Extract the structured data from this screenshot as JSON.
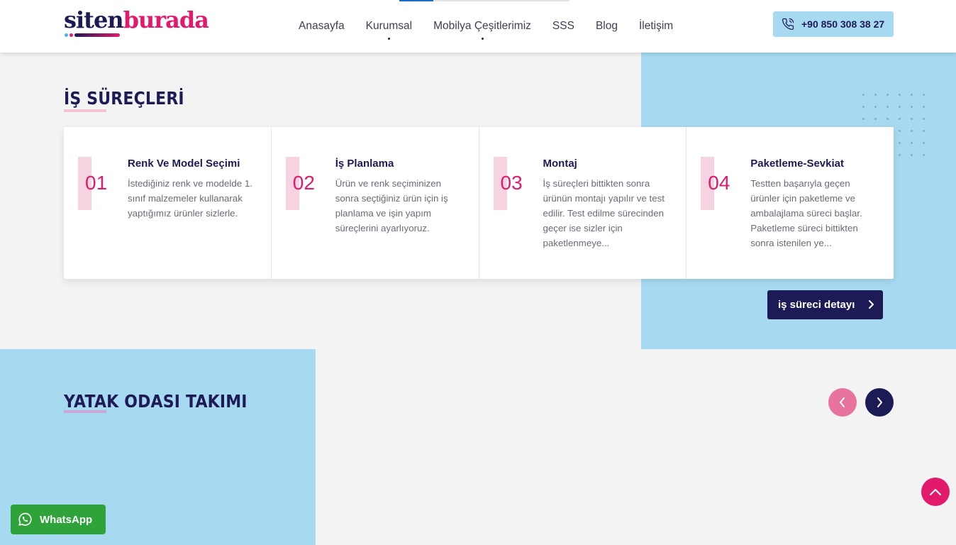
{
  "header": {
    "logo_part1": "siten",
    "logo_part2": "burada",
    "nav": [
      {
        "label": "Anasayfa"
      },
      {
        "label": "Kurumsal"
      },
      {
        "label": "Mobilya Çeşitlerimiz"
      },
      {
        "label": "SSS"
      },
      {
        "label": "Blog"
      },
      {
        "label": "İletişim"
      }
    ],
    "phone": "+90 850 308 38 27"
  },
  "process": {
    "title": "İŞ SÜREÇLERİ",
    "steps": [
      {
        "num": "01",
        "title": "Renk Ve Model Seçimi",
        "desc": "İstediğiniz renk ve modelde 1. sınıf malzemeler kullanarak yaptığımız ürünler sizlerle."
      },
      {
        "num": "02",
        "title": "İş Planlama",
        "desc": "Ürün ve renk seçiminizen sonra seçtiğiniz ürün için iş planlama ve işin yapım süreçlerini ayarlıyoruz."
      },
      {
        "num": "03",
        "title": "Montaj",
        "desc": "İş süreçleri bittikten sonra ürünün montajı yapılır ve test edilir. Test edilme sürecinden geçer ise sizler için paketlenmeye..."
      },
      {
        "num": "04",
        "title": "Paketleme-Sevkiat",
        "desc": "Testten başarıyla geçen ürünler için paketleme ve ambalajlama süreci başlar. Paketleme süreci bittikten sonra istenilen ye..."
      }
    ],
    "detail_button": "iş süreci detayı"
  },
  "bedroom": {
    "title": "YATAK ODASI TAKIMI"
  },
  "whatsapp_label": "WhatsApp",
  "colors": {
    "navy": "#1d1b55",
    "pink": "#e21a6b",
    "light_blue": "#a7d9f0",
    "whatsapp_green": "#2da33a"
  }
}
